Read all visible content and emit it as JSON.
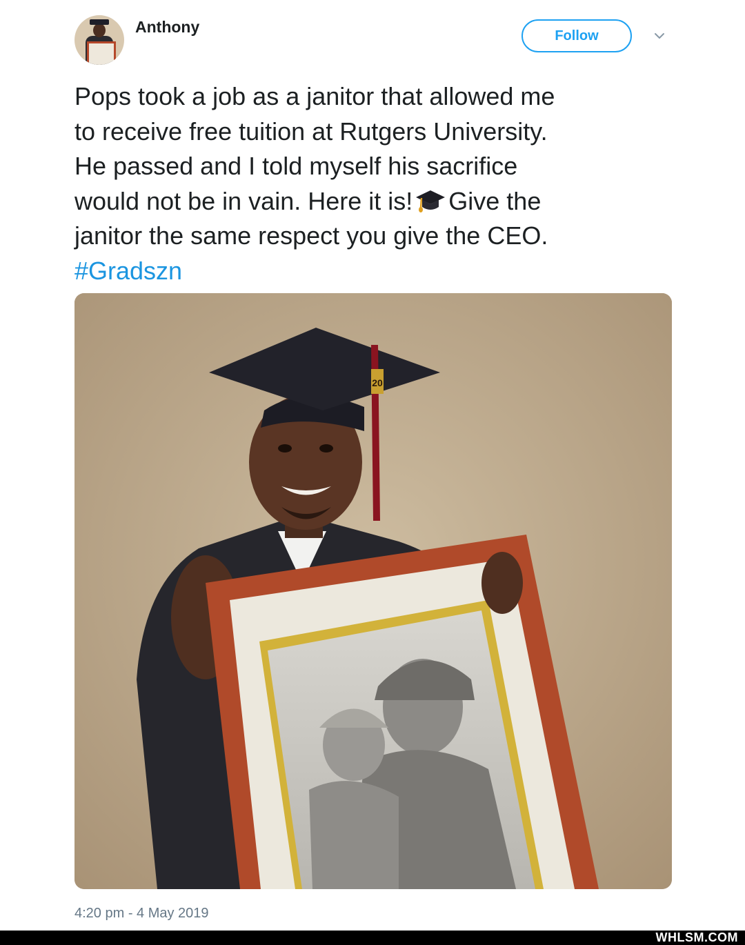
{
  "author": {
    "name": "Anthony",
    "avatar_icon": "user-avatar"
  },
  "actions": {
    "follow_label": "Follow",
    "menu_icon": "chevron-down-icon"
  },
  "tweet": {
    "lines": [
      "Pops took a job as a janitor that allowed me",
      "to receive free tuition at Rutgers University.",
      "He passed and I told myself his sacrifice",
      "would not be in vain. Here it is!",
      "Give the",
      "janitor the same respect you give the CEO."
    ],
    "emoji_icon": "graduation-cap-icon",
    "hashtag": "#Gradszn",
    "hashtag_color": "#1b95e0"
  },
  "media": {
    "cap_tassel_year": "20"
  },
  "timestamp": "4:20 pm - 4 May 2019",
  "watermark": "WHLSM.COM",
  "colors": {
    "accent": "#1da1f2",
    "text": "#1c2022",
    "muted": "#657786"
  }
}
